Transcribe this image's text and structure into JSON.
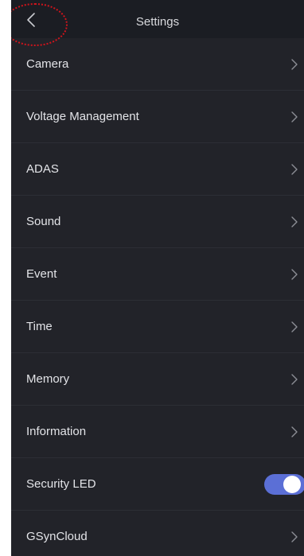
{
  "header": {
    "title": "Settings",
    "back_icon": "chevron-left-icon"
  },
  "colors": {
    "background": "#222329",
    "header_background": "#1b1d23",
    "toggle_on": "#5b6fd6",
    "annotation": "#d0141c"
  },
  "settings": {
    "items": [
      {
        "label": "Camera",
        "control": "chevron"
      },
      {
        "label": "Voltage Management",
        "control": "chevron"
      },
      {
        "label": "ADAS",
        "control": "chevron"
      },
      {
        "label": "Sound",
        "control": "chevron"
      },
      {
        "label": "Event",
        "control": "chevron"
      },
      {
        "label": "Time",
        "control": "chevron"
      },
      {
        "label": "Memory",
        "control": "chevron"
      },
      {
        "label": "Information",
        "control": "chevron"
      },
      {
        "label": "Security LED",
        "control": "toggle",
        "value": true
      },
      {
        "label": "GSynCloud",
        "control": "chevron"
      }
    ]
  }
}
